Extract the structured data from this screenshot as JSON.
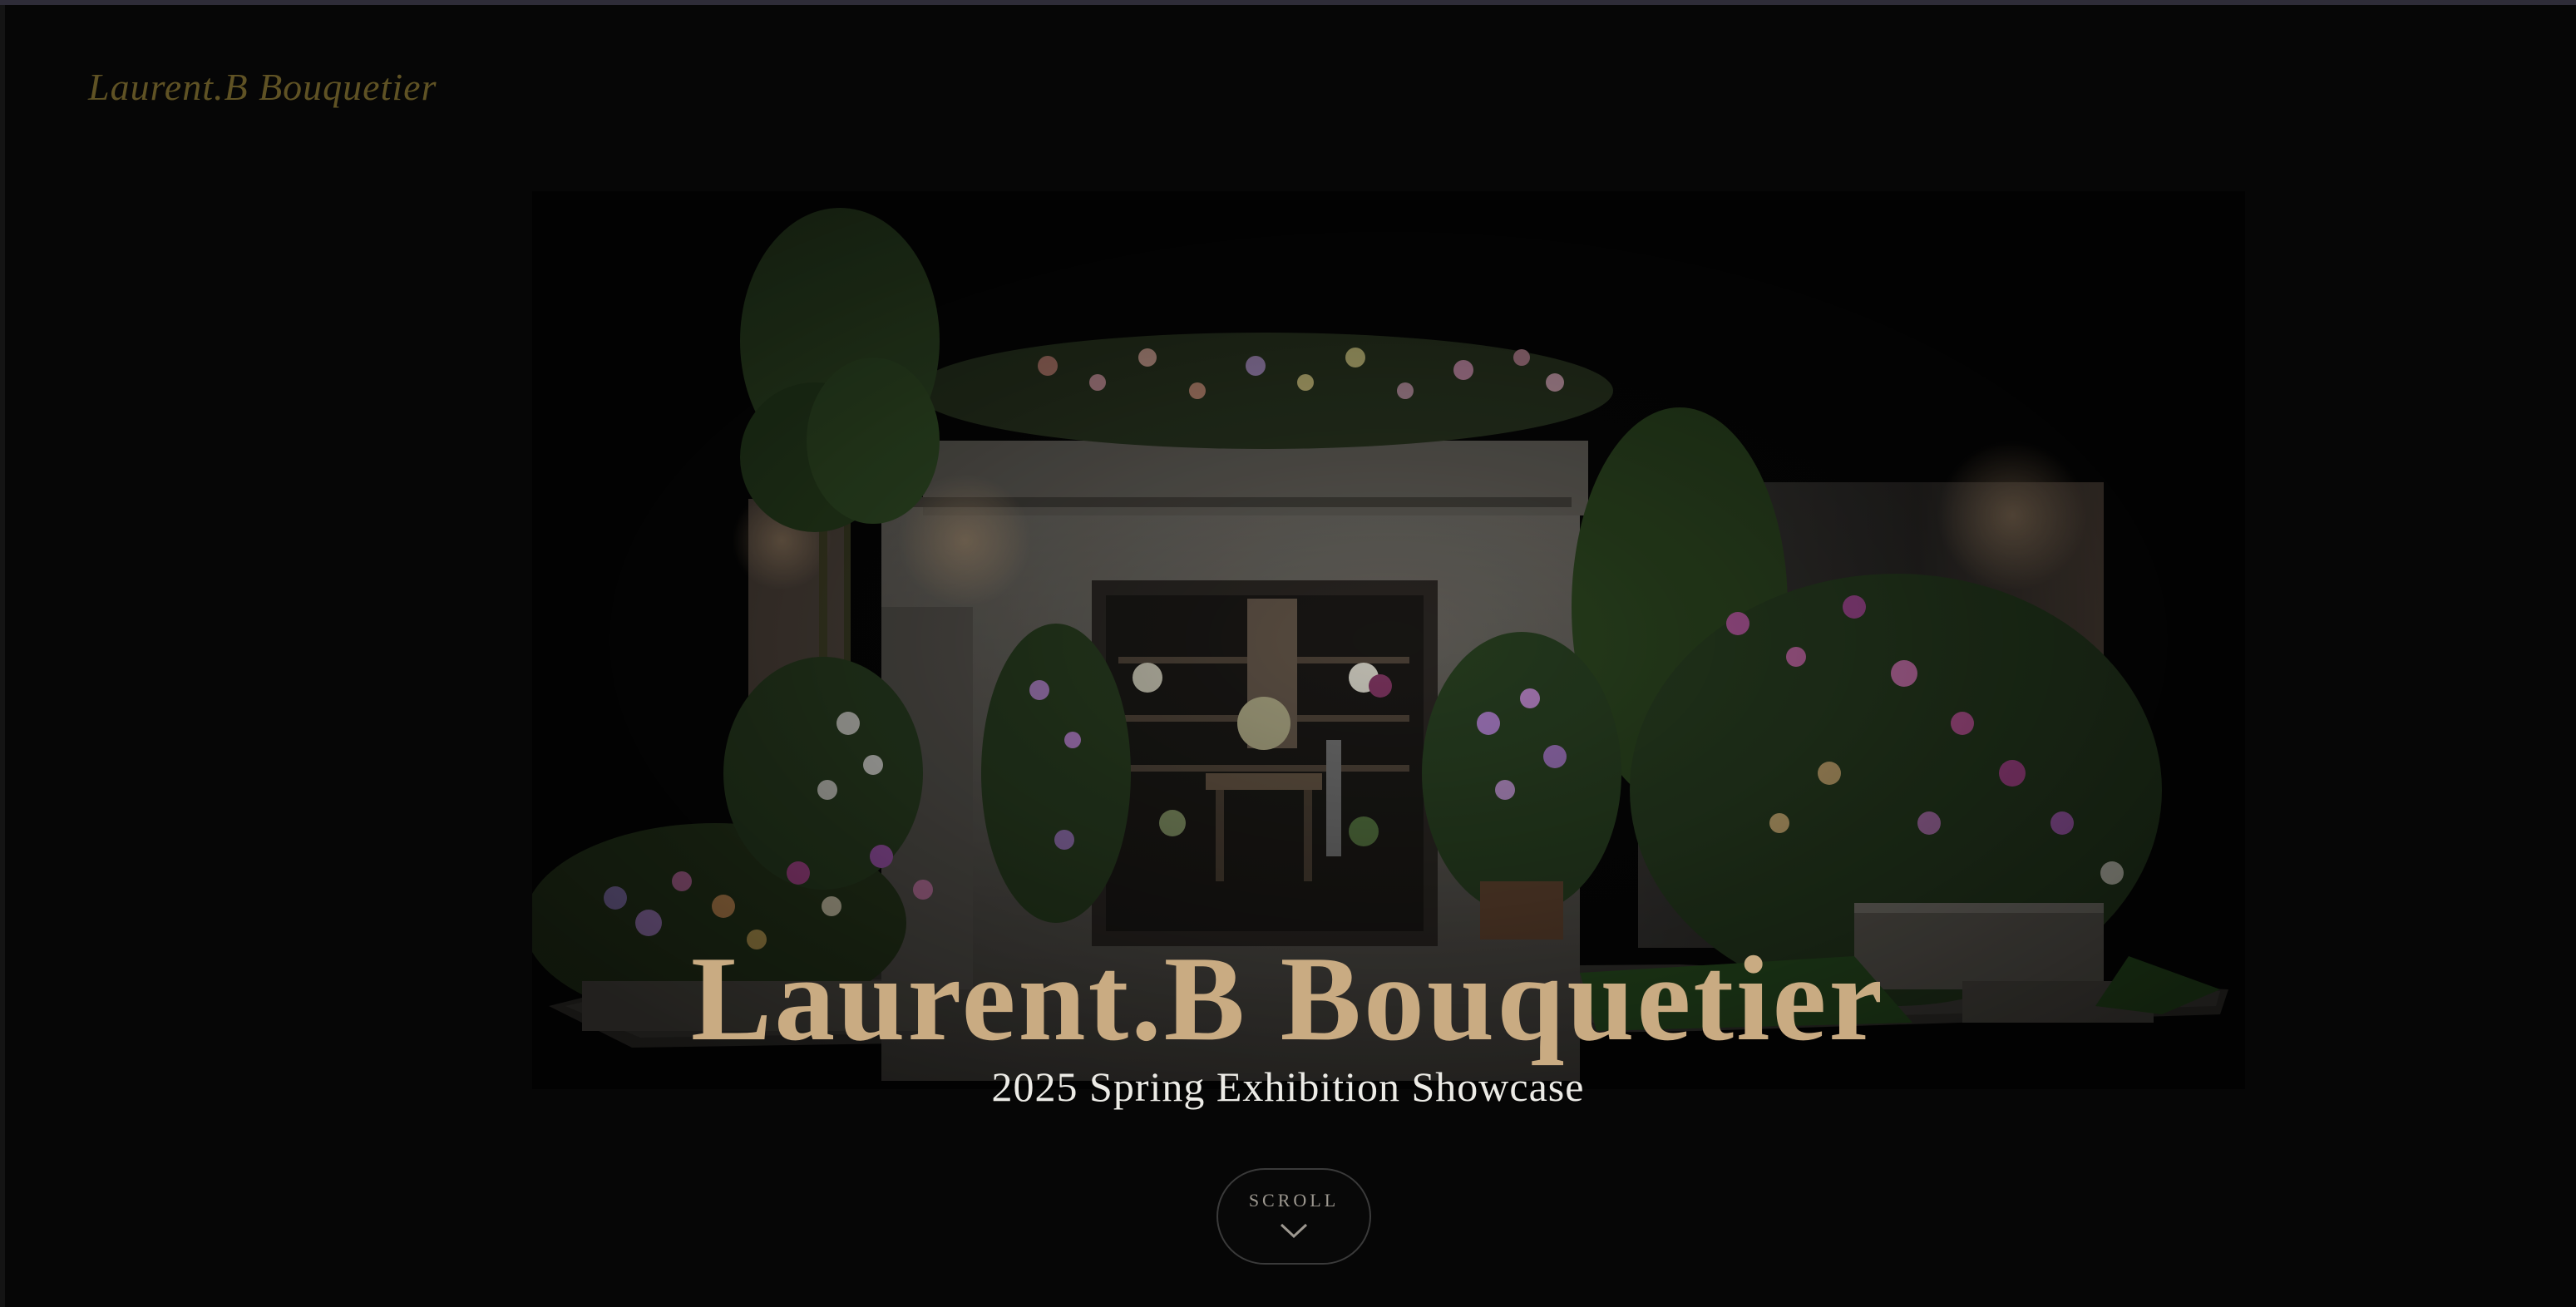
{
  "brand": {
    "logo_text": "Laurent.B Bouquetier"
  },
  "hero": {
    "title": "Laurent.B Bouquetier",
    "subtitle": "2025 Spring Exhibition Showcase"
  },
  "scroll": {
    "label": "SCROLL",
    "icon": "chevron-down-icon"
  },
  "colors": {
    "background": "#060606",
    "title_gold": "#c9ab82",
    "logo_gold": "#5f5224",
    "subtitle": "#ecebe6"
  }
}
